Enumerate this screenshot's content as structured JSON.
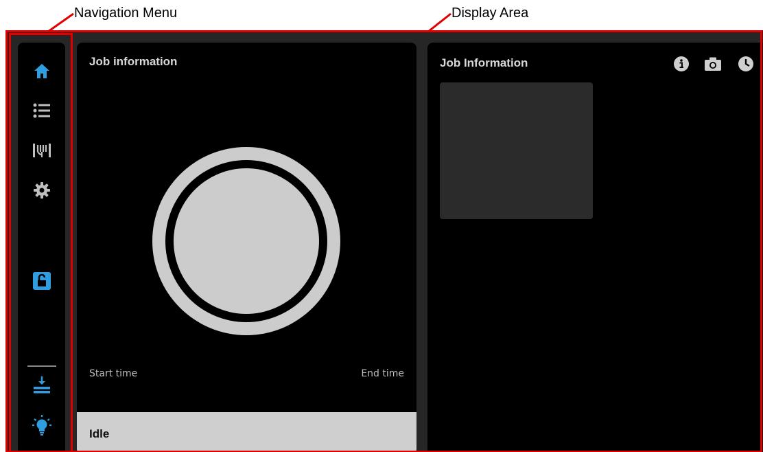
{
  "callouts": {
    "navigation_menu": "Navigation Menu",
    "display_area": "Display Area"
  },
  "nav": {
    "items": [
      {
        "icon": "home-icon"
      },
      {
        "icon": "list-icon"
      },
      {
        "icon": "filament-icon"
      },
      {
        "icon": "gear-icon"
      },
      {
        "icon": "unlock-icon"
      },
      {
        "icon": "unload-icon"
      },
      {
        "icon": "light-bulb-icon"
      }
    ]
  },
  "left_card": {
    "title": "Job information",
    "start_label": "Start time",
    "end_label": "End time",
    "status": "Idle"
  },
  "right_card": {
    "title": "Job Information",
    "icons": [
      "info-icon",
      "camera-icon",
      "clock-icon"
    ]
  },
  "colors": {
    "accent": "#2f9ee0",
    "background": "#262626",
    "panel": "#000000",
    "callout": "#e00000",
    "ring": "#cccccc",
    "status_bar": "#cfcfcf"
  }
}
